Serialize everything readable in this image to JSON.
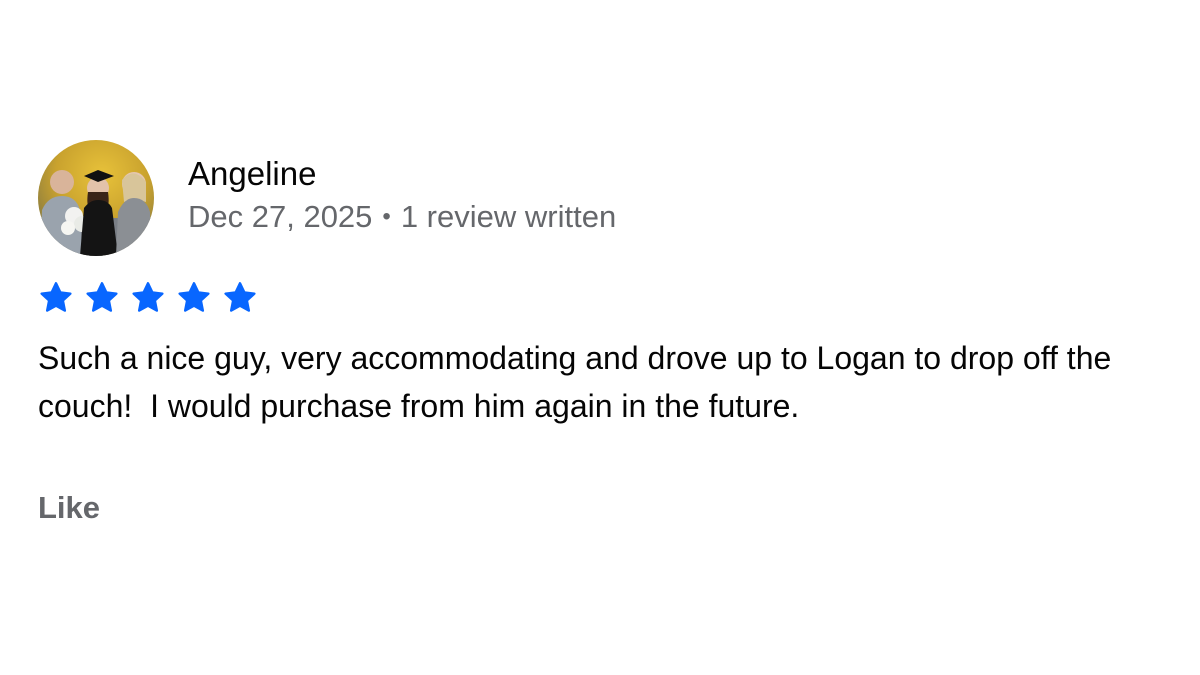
{
  "review": {
    "author": {
      "name": "Angeline",
      "avatar": "avatar-photo-icon"
    },
    "date": "Dec 27, 2025",
    "separator": "•",
    "review_count": "1 review written",
    "rating": 5,
    "rating_max": 5,
    "star_color": "#0866ff",
    "text": "Such a nice guy, very accommodating and drove up to Logan to drop off the couch!  I would purchase from him again in the future.",
    "like_label": "Like"
  },
  "colors": {
    "primary_text": "#050505",
    "secondary_text": "#65676b",
    "accent": "#0866ff"
  }
}
